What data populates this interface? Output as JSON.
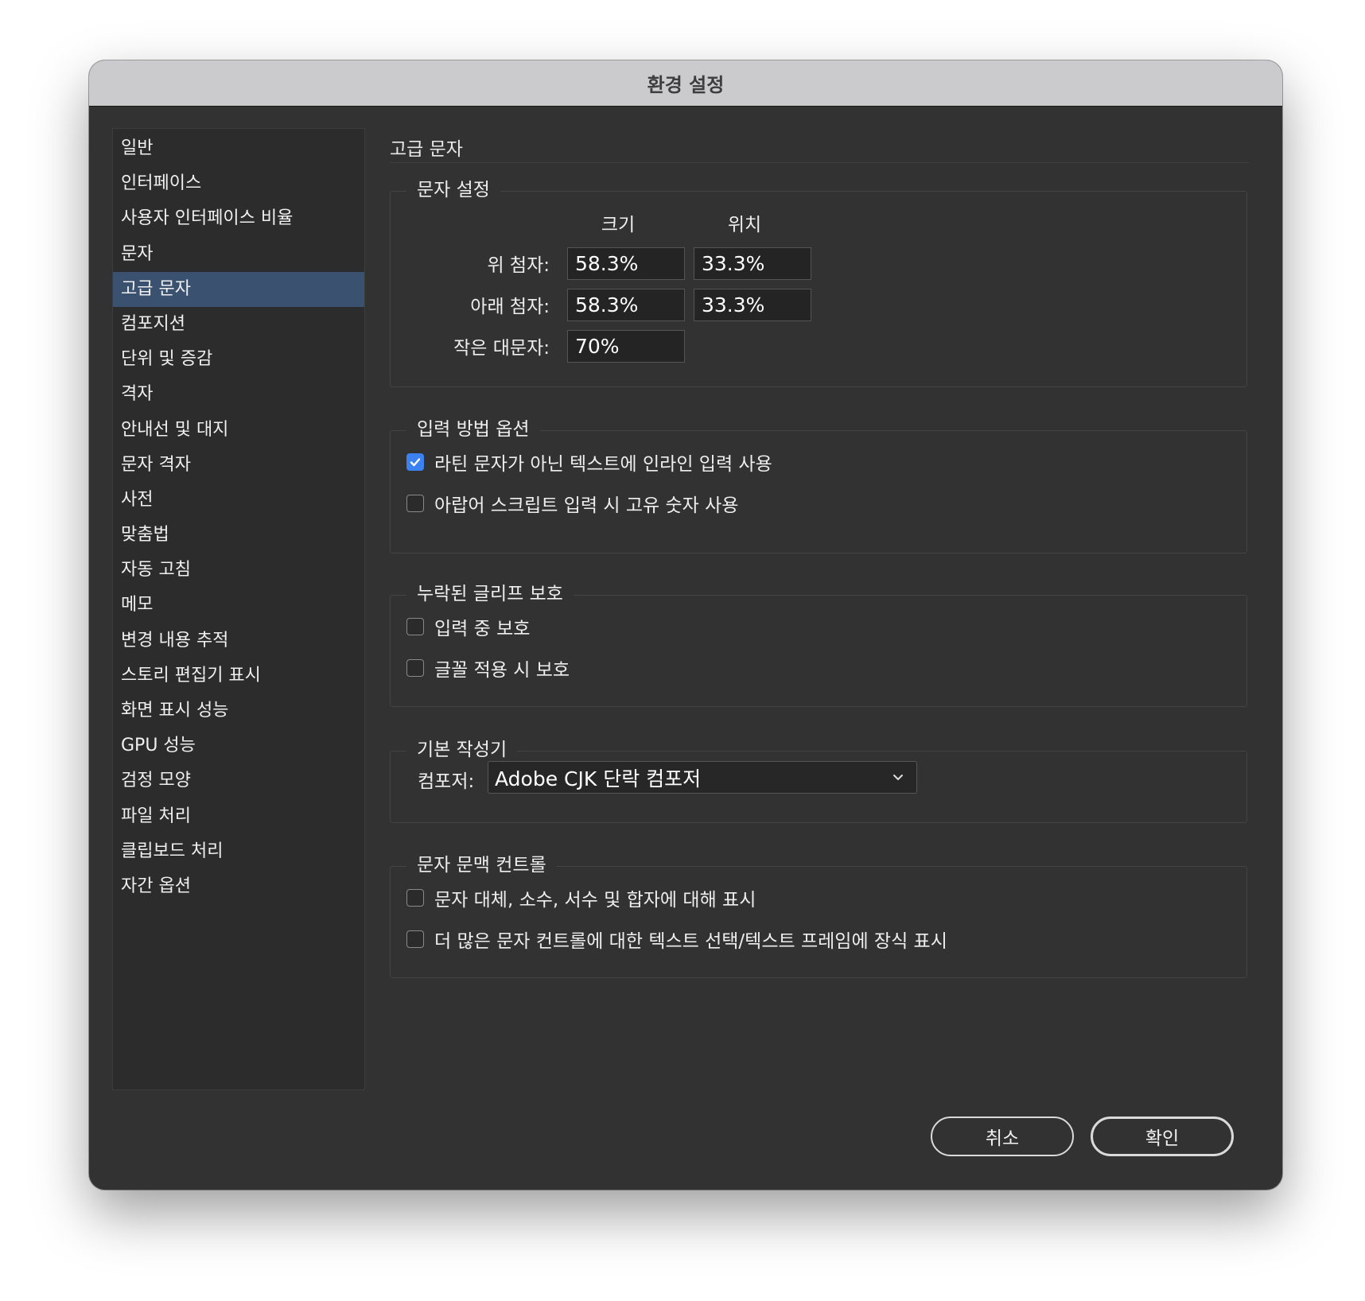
{
  "window": {
    "title": "환경 설정"
  },
  "sidebar": {
    "selected_index": 4,
    "items": [
      "일반",
      "인터페이스",
      "사용자 인터페이스 비율",
      "문자",
      "고급 문자",
      "컴포지션",
      "단위 및 증감",
      "격자",
      "안내선 및 대지",
      "문자 격자",
      "사전",
      "맞춤법",
      "자동 고침",
      "메모",
      "변경 내용 추적",
      "스토리 편집기 표시",
      "화면 표시 성능",
      "GPU 성능",
      "검정 모양",
      "파일 처리",
      "클립보드 처리",
      "자간 옵션"
    ]
  },
  "page": {
    "title": "고급 문자"
  },
  "char_settings": {
    "legend": "문자 설정",
    "col_size": "크기",
    "col_position": "위치",
    "superscript": {
      "label": "위 첨자:",
      "size": "58.3%",
      "position": "33.3%"
    },
    "subscript": {
      "label": "아래 첨자:",
      "size": "58.3%",
      "position": "33.3%"
    },
    "small_caps": {
      "label": "작은 대문자:",
      "size": "70%"
    }
  },
  "input_method": {
    "legend": "입력 방법 옵션",
    "inline_input": {
      "label": "라틴 문자가 아닌 텍스트에 인라인 입력 사용",
      "checked": true
    },
    "native_digits": {
      "label": "아랍어 스크립트 입력 시 고유 숫자 사용",
      "checked": false
    }
  },
  "missing_glyph": {
    "legend": "누락된 글리프 보호",
    "while_typing": {
      "label": "입력 중 보호",
      "checked": false
    },
    "font_applied": {
      "label": "글꼴 적용 시 보호",
      "checked": false
    }
  },
  "default_composer": {
    "legend": "기본 작성기",
    "composer_label": "컴포저:",
    "composer_value": "Adobe CJK 단락 컴포저"
  },
  "contextual_controls": {
    "legend": "문자 문맥 컨트롤",
    "alternates": {
      "label": "문자 대체, 소수, 서수 및 합자에 대해 표시",
      "checked": false
    },
    "adornment": {
      "label": "더 많은 문자 컨트롤에 대한 텍스트 선택/텍스트 프레임에 장식 표시",
      "checked": false
    }
  },
  "buttons": {
    "cancel": "취소",
    "ok": "확인"
  },
  "colors": {
    "window_bg": "#323232",
    "titlebar_bg": "#cbcacd",
    "selection": "#3a5270",
    "checkbox_accent": "#3b82f0"
  }
}
